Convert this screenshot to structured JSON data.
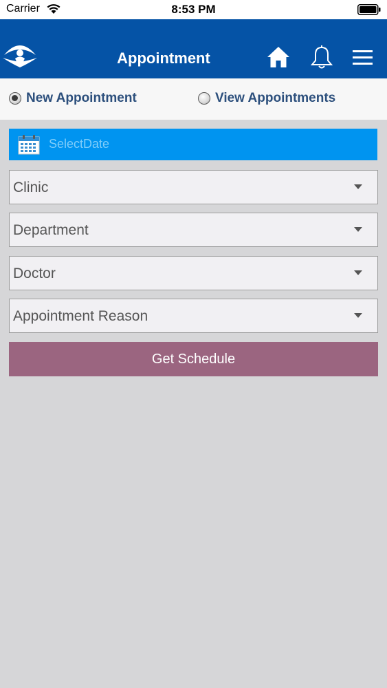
{
  "status_bar": {
    "carrier": "Carrier",
    "time": "8:53 PM"
  },
  "header": {
    "title": "Appointment",
    "icons": [
      "logo-icon",
      "home-icon",
      "bell-icon",
      "menu-icon"
    ],
    "background_color": "#0553a6"
  },
  "tabs": {
    "options": [
      {
        "label": "New Appointment",
        "selected": true
      },
      {
        "label": "View Appointments",
        "selected": false
      }
    ]
  },
  "form": {
    "date_placeholder": "SelectDate",
    "date_field_color": "#0094f0",
    "selects": [
      {
        "label": "Clinic"
      },
      {
        "label": "Department"
      },
      {
        "label": "Doctor"
      },
      {
        "label": "Appointment Reason"
      }
    ],
    "button_label": "Get Schedule",
    "button_color": "#9b6580"
  }
}
